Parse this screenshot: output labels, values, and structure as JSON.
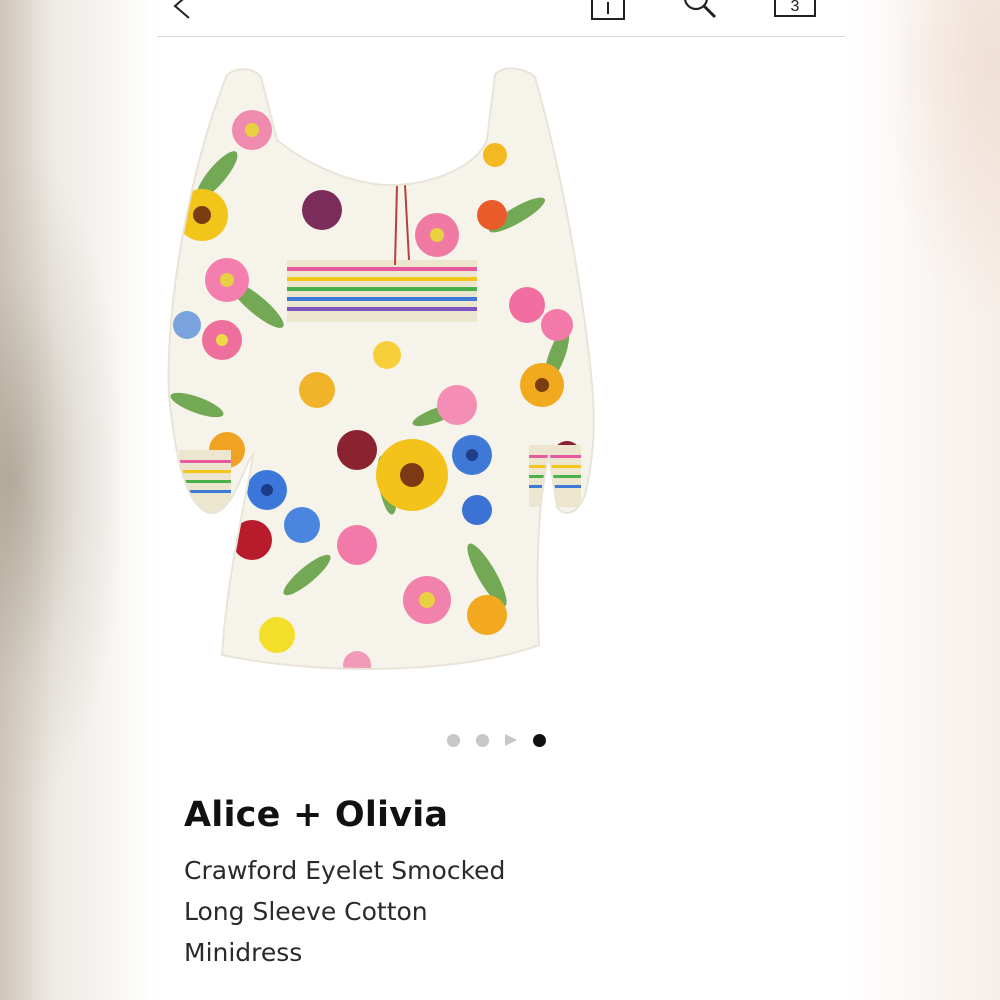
{
  "header": {
    "back": "back-arrow-icon",
    "share": "share-icon",
    "search": "search-icon",
    "bag": {
      "icon": "bag-icon",
      "count": "3"
    }
  },
  "product": {
    "brand": "Alice + Olivia",
    "title_lines": [
      "Crawford Eyelet Smocked",
      "Long Sleeve Cotton",
      "Minidress"
    ],
    "image": "floral-print-minidress-image"
  },
  "carousel": {
    "total": 4,
    "active_index": 3
  },
  "colors": {
    "text": "#111111",
    "muted_dot": "#c7c7c7",
    "active_dot": "#111111",
    "divider": "#d8d8d8"
  }
}
